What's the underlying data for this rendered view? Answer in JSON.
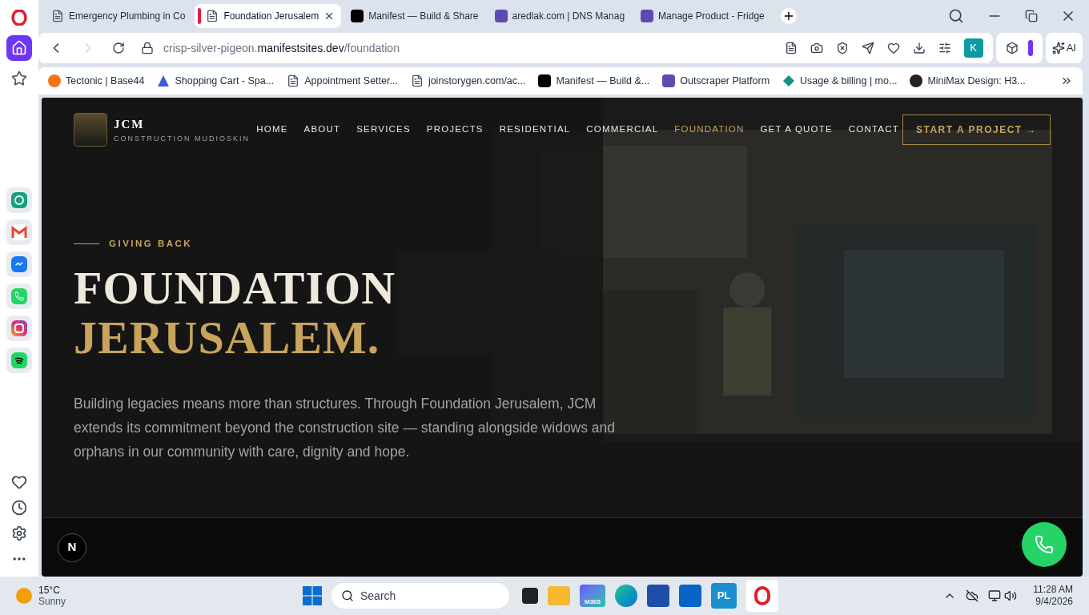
{
  "tabs": [
    {
      "title": "Emergency Plumbing in Co",
      "selected": false,
      "kind": "page"
    },
    {
      "title": "Foundation Jerusalem",
      "selected": true,
      "kind": "page"
    },
    {
      "title": "Manifest — Build & Share",
      "selected": false,
      "kind": "m"
    },
    {
      "title": "aredlak.com | DNS Manag",
      "selected": false,
      "kind": "box"
    },
    {
      "title": "Manage Product - Fridge",
      "selected": false,
      "kind": "box"
    }
  ],
  "address": {
    "parts": [
      {
        "text": "crisp-silver-pigeon.",
        "strong": false
      },
      {
        "text": "manifestsites.dev",
        "strong": true
      },
      {
        "text": "/foundation",
        "strong": false
      }
    ],
    "profile": "K",
    "ai": "AI"
  },
  "bookmarks": [
    {
      "title": "Tectonic | Base44",
      "kind": "dot"
    },
    {
      "title": "Shopping Cart - Spa...",
      "kind": "triangle"
    },
    {
      "title": "Appointment Setter...",
      "kind": "page"
    },
    {
      "title": "joinstorygen.com/ac...",
      "kind": "page"
    },
    {
      "title": "Manifest — Build &...",
      "kind": "m"
    },
    {
      "title": "Outscraper Platform",
      "kind": "box"
    },
    {
      "title": "Usage & billing | mo...",
      "kind": "diamond"
    },
    {
      "title": "MiniMax Design: H3...",
      "kind": "avatar"
    }
  ],
  "site": {
    "brand": "JCM",
    "tagline": "CONSTRUCTION MUDIOSKIN",
    "nav": [
      {
        "label": "HOME",
        "selected": false
      },
      {
        "label": "ABOUT",
        "selected": false
      },
      {
        "label": "SERVICES",
        "selected": false
      },
      {
        "label": "PROJECTS",
        "selected": false
      },
      {
        "label": "RESIDENTIAL",
        "selected": false
      },
      {
        "label": "COMMERCIAL",
        "selected": false
      },
      {
        "label": "FOUNDATION",
        "selected": true
      },
      {
        "label": "GET A QUOTE",
        "selected": false
      },
      {
        "label": "CONTACT",
        "selected": false
      }
    ],
    "cta": "START A PROJECT →",
    "eyebrow": "GIVING BACK",
    "title_line1": "FOUNDATION",
    "title_line2": "JERUSALEM.",
    "intro": "Building legacies means more than structures. Through Foundation Jerusalem, JCM extends its commitment beyond the construction site — standing alongside widows and orphans in our community with care, dignity and hope.",
    "badge": "N"
  },
  "taskbar": {
    "temperature": "15°C",
    "weather": "Sunny",
    "search_placeholder": "Search",
    "m365": "M365",
    "pl": "PL",
    "time": "11:28 AM",
    "date": "9/4/2026"
  }
}
